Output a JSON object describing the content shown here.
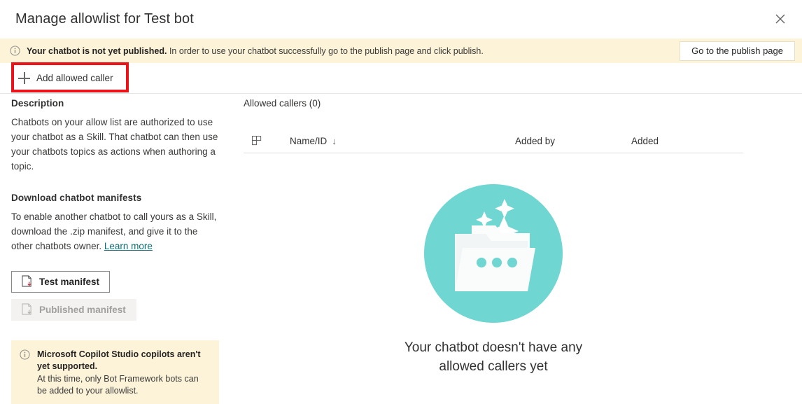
{
  "dialog": {
    "title": "Manage allowlist for Test bot",
    "close_icon": "close-icon"
  },
  "banner": {
    "icon": "info-icon",
    "bold_text": "Your chatbot is not yet published.",
    "text": " In order to use your chatbot successfully go to the publish page and click publish.",
    "button_label": "Go to the publish page",
    "background": "#fdf3d8"
  },
  "commandbar": {
    "add_icon": "plus-icon",
    "add_label": "Add allowed caller",
    "highlight_color": "#e8141a"
  },
  "sidebar": {
    "description_heading": "Description",
    "description_body": "Chatbots on your allow list are authorized to use your chatbot as a Skill. That chatbot can then use your chatbots topics as actions when authoring a topic.",
    "download_heading": "Download chatbot manifests",
    "download_body": "To enable another chatbot to call yours as a Skill, download the .zip manifest, and give it to the other chatbots owner. ",
    "learn_more": "Learn more",
    "test_manifest_label": "Test manifest",
    "test_manifest_icon": "document-download-icon",
    "published_manifest_label": "Published manifest",
    "published_manifest_icon": "document-download-icon",
    "warning": {
      "icon": "info-icon",
      "bold_text": "Microsoft Copilot Studio copilots aren't yet supported.",
      "text": "At this time, only Bot Framework bots can be added to your allowlist.",
      "background": "#fdf3d8"
    }
  },
  "content": {
    "list_title": "Allowed callers (0)",
    "table": {
      "grid_icon": "grid-columns-icon",
      "columns": [
        {
          "label": "Name/ID",
          "sort_icon": "↓"
        },
        {
          "label": "Added by",
          "sort_icon": ""
        },
        {
          "label": "Added",
          "sort_icon": ""
        }
      ],
      "rows": []
    },
    "empty_state": {
      "illustration": "folder-sparkles-illustration",
      "circle_color": "#6fd6d2",
      "folder_color": "#f4f6f7",
      "caption": "Your chatbot doesn't have any allowed callers yet"
    }
  }
}
